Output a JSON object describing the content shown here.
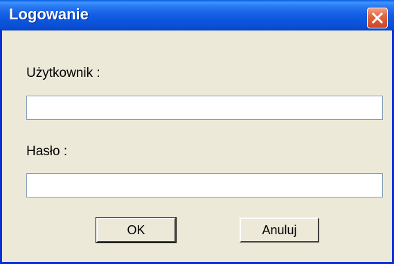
{
  "window": {
    "title": "Logowanie",
    "close_icon": "close-icon"
  },
  "form": {
    "user_label": "Użytkownik :",
    "user_value": "",
    "password_label": "Hasło :",
    "password_value": ""
  },
  "buttons": {
    "ok_label": "OK",
    "cancel_label": "Anuluj"
  },
  "colors": {
    "titlebar": "#0a55dc",
    "frame": "#0831d9",
    "dialog_background": "#ece9d8",
    "close_button": "#e2663f"
  }
}
